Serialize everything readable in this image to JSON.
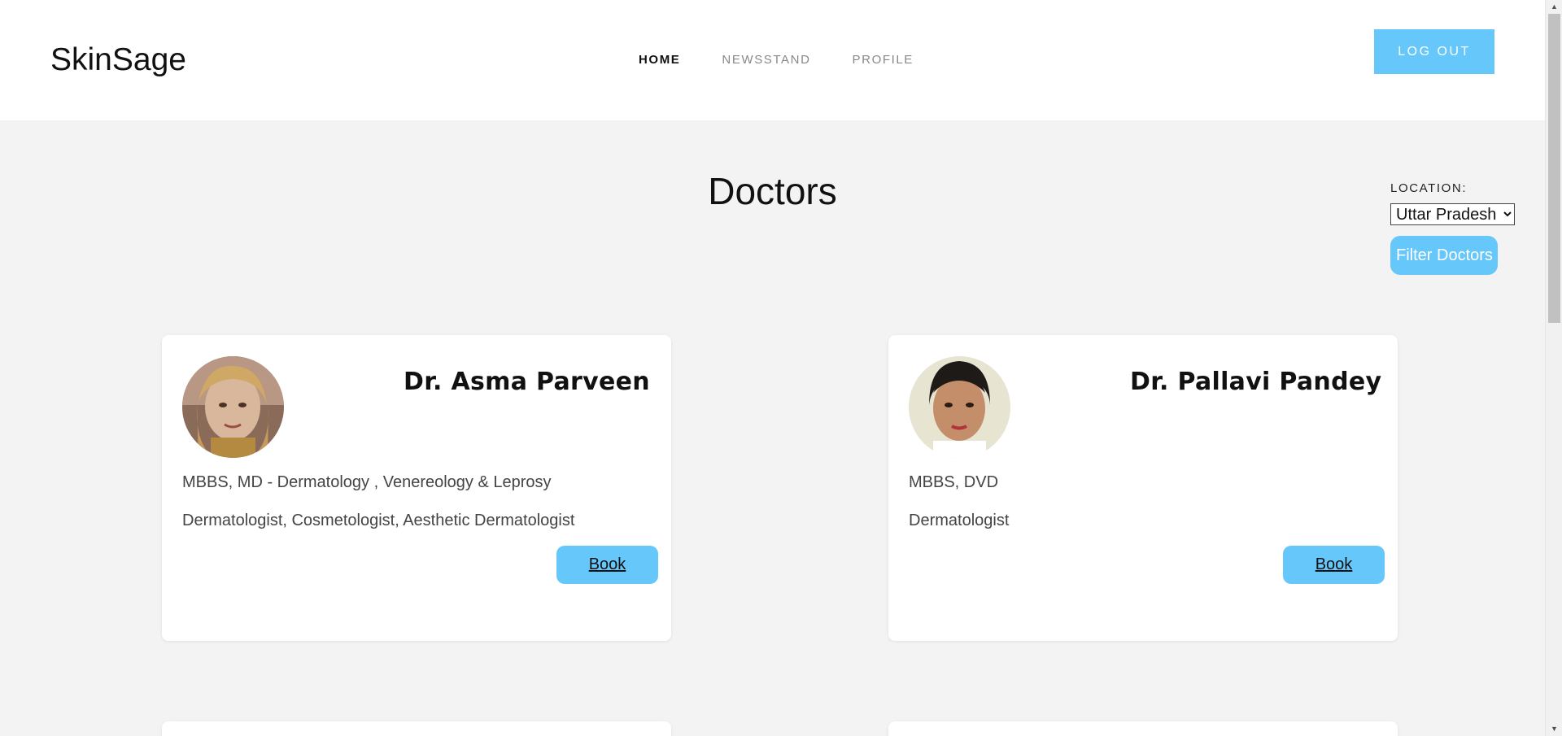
{
  "header": {
    "brand": "SkinSage",
    "nav": [
      {
        "label": "HOME",
        "active": true
      },
      {
        "label": "NEWSSTAND",
        "active": false
      },
      {
        "label": "PROFILE",
        "active": false
      }
    ],
    "logout_label": "LOG OUT"
  },
  "main": {
    "title": "Doctors",
    "filter": {
      "label": "LOCATION:",
      "selected": "Uttar Pradesh",
      "button_label": "Filter Doctors"
    },
    "doctors": [
      {
        "name": "Dr. Asma Parveen",
        "qualifications": "MBBS, MD - Dermatology , Venereology & Leprosy",
        "specialties": "Dermatologist, Cosmetologist, Aesthetic Dermatologist",
        "book_label": "Book"
      },
      {
        "name": "Dr. Pallavi Pandey",
        "qualifications": "MBBS, DVD",
        "specialties": "Dermatologist",
        "book_label": "Book"
      }
    ]
  },
  "colors": {
    "accent": "#66c7fb",
    "page_background": "#f3f3f3",
    "card_background": "#ffffff"
  },
  "icons": {
    "scroll_up": "▲",
    "scroll_down": "▼"
  }
}
